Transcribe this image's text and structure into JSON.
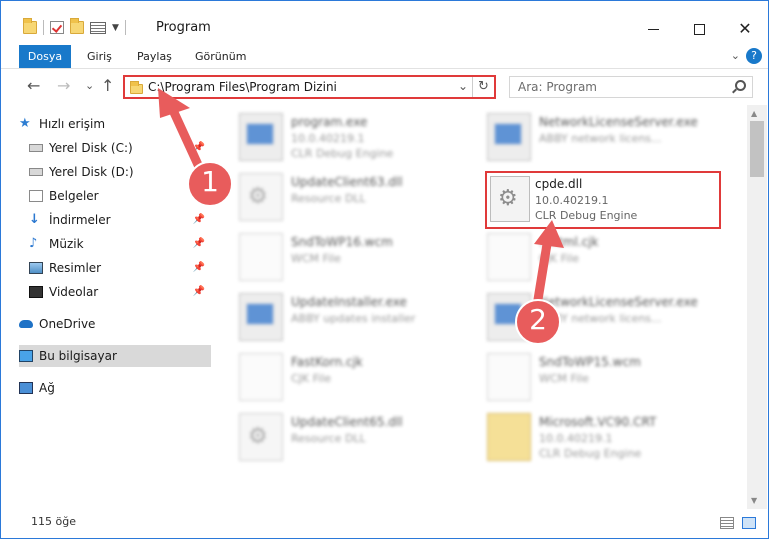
{
  "window": {
    "title": "Program",
    "buttons": {
      "minimize": "—",
      "maximize": "",
      "close": "✕"
    }
  },
  "ribbon": {
    "tabs": [
      "Dosya",
      "Giriş",
      "Paylaş",
      "Görünüm"
    ],
    "help": "?",
    "expand": "⌄"
  },
  "nav": {
    "back": "←",
    "forward": "→",
    "recent": "⌄",
    "up": "↑",
    "address": "C:\\Program Files\\Program Dizini",
    "address_dropdown": "⌄",
    "refresh": "↻",
    "search_placeholder": "Ara: Program"
  },
  "sidebar": {
    "items": [
      {
        "label": "Hızlı erişim",
        "icon": "star-icon"
      },
      {
        "label": "Yerel Disk (C:)",
        "icon": "drive-icon",
        "pinned": true
      },
      {
        "label": "Yerel Disk (D:)",
        "icon": "drive-icon"
      },
      {
        "label": "Belgeler",
        "icon": "document-icon"
      },
      {
        "label": "İndirmeler",
        "icon": "download-icon",
        "pinned": true
      },
      {
        "label": "Müzik",
        "icon": "music-icon",
        "pinned": true
      },
      {
        "label": "Resimler",
        "icon": "pictures-icon",
        "pinned": true
      },
      {
        "label": "Videolar",
        "icon": "videos-icon",
        "pinned": true
      },
      {
        "label": "OneDrive",
        "icon": "onedrive-icon"
      },
      {
        "label": "Bu bilgisayar",
        "icon": "this-pc-icon",
        "selected": true
      },
      {
        "label": "Ağ",
        "icon": "network-icon"
      }
    ],
    "pin_glyph": "📌"
  },
  "files": [
    {
      "name": "program.exe",
      "line1": "10.0.40219.1",
      "line2": "CLR Debug Engine",
      "icon": "app-icon"
    },
    {
      "name": "NetworkLicenseServer.exe",
      "line1": "ABBY network licens...",
      "line2": "",
      "icon": "app-icon"
    },
    {
      "name": "UpdateClient63.dll",
      "line1": "Resource DLL",
      "line2": "",
      "icon": "gear-file-icon"
    },
    {
      "name": "SndToWP16.wcm",
      "line1": "WCM File",
      "line2": "",
      "icon": "page-icon"
    },
    {
      "name": "...html.cjk",
      "line1": "CJK File",
      "line2": "",
      "icon": "page-icon"
    },
    {
      "name": "UpdateInstaller.exe",
      "line1": "ABBY updates installer",
      "line2": "",
      "icon": "app-icon"
    },
    {
      "name": "NetworkLicenseServer.exe",
      "line1": "ABBY network licens...",
      "line2": "",
      "icon": "app-icon"
    },
    {
      "name": "FastKorn.cjk",
      "line1": "CJK File",
      "line2": "",
      "icon": "page-icon"
    },
    {
      "name": "SndToWP15.wcm",
      "line1": "WCM File",
      "line2": "",
      "icon": "page-icon"
    },
    {
      "name": "UpdateClient65.dll",
      "line1": "Resource DLL",
      "line2": "",
      "icon": "gear-file-icon"
    },
    {
      "name": "Microsoft.VC90.CRT",
      "line1": "10.0.40219.1",
      "line2": "CLR Debug Engine",
      "icon": "folder-zip-icon"
    }
  ],
  "highlighted_file": {
    "name": "cpde.dll",
    "line1": "10.0.40219.1",
    "line2": "CLR Debug Engine",
    "icon": "gear-file-icon"
  },
  "status": {
    "count": "115 öğe"
  },
  "annotations": [
    {
      "label": "1",
      "color": "#e85c5c"
    },
    {
      "label": "2",
      "color": "#e85c5c"
    }
  ]
}
